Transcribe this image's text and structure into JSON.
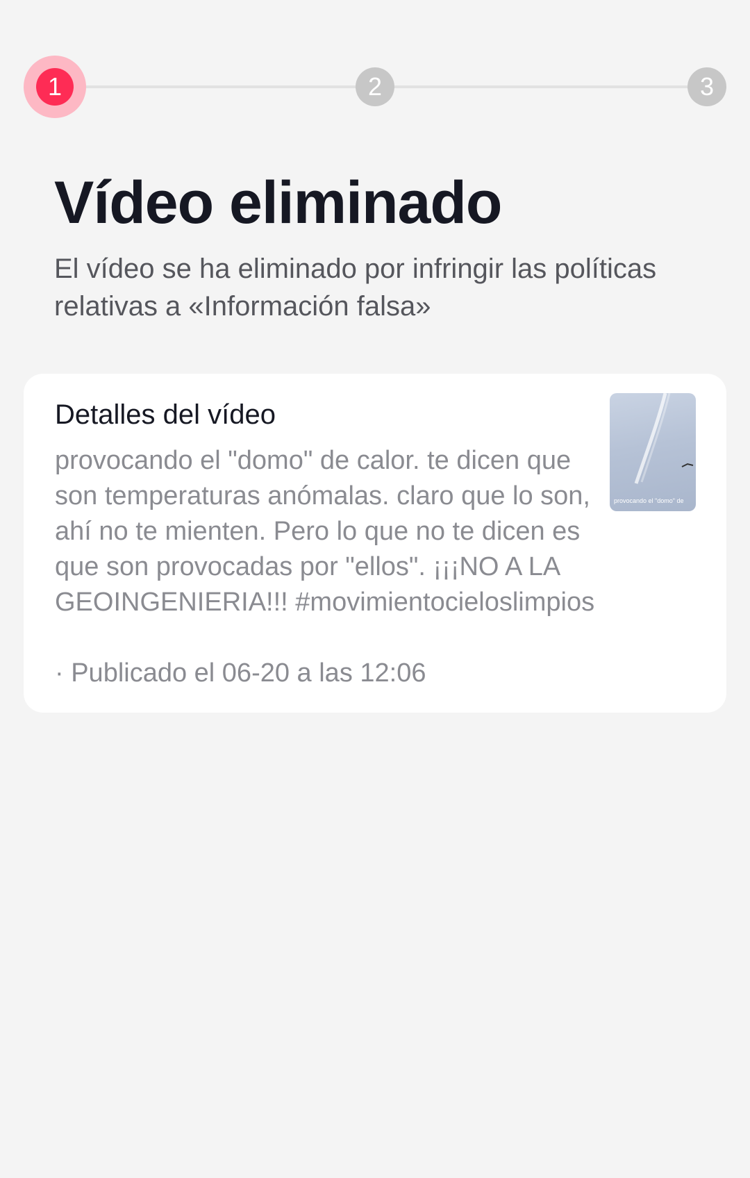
{
  "stepper": {
    "steps": [
      "1",
      "2",
      "3"
    ],
    "active_step": 1,
    "accent_color": "#fe2c55"
  },
  "header": {
    "title": "Vídeo eliminado",
    "subtitle": "El vídeo se ha eliminado por infringir las políticas relativas a «Información falsa»"
  },
  "video_card": {
    "title": "Detalles del vídeo",
    "description": "provocando el \"domo\" de calor. te dicen que son temperaturas anómalas. claro que lo son, ahí no te mienten. Pero lo que no te dicen es que son provocadas por \"ellos\". ¡¡¡NO A LA GEOINGENIERIA!!! #movimientocieloslimpios",
    "published": "· Publicado el 06-20 a las 12:06",
    "thumbnail_caption": "provocando el \"domo\" de"
  }
}
